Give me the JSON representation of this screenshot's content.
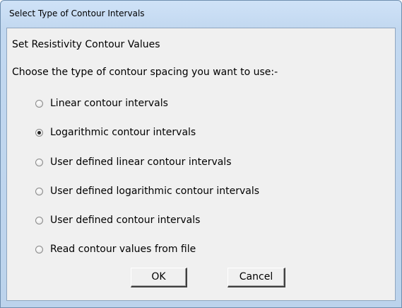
{
  "window": {
    "title": "Select Type of Contour Intervals"
  },
  "dialog": {
    "heading": "Set Resistivity Contour Values",
    "prompt": "Choose the type of contour spacing you want to use:-",
    "options": [
      {
        "label": "Linear contour intervals",
        "selected": false
      },
      {
        "label": "Logarithmic contour intervals",
        "selected": true
      },
      {
        "label": "User defined linear contour intervals",
        "selected": false
      },
      {
        "label": "User defined logarithmic contour intervals",
        "selected": false
      },
      {
        "label": "User defined contour intervals",
        "selected": false
      },
      {
        "label": "Read contour values from file",
        "selected": false
      }
    ],
    "ok_label": "OK",
    "cancel_label": "Cancel"
  }
}
